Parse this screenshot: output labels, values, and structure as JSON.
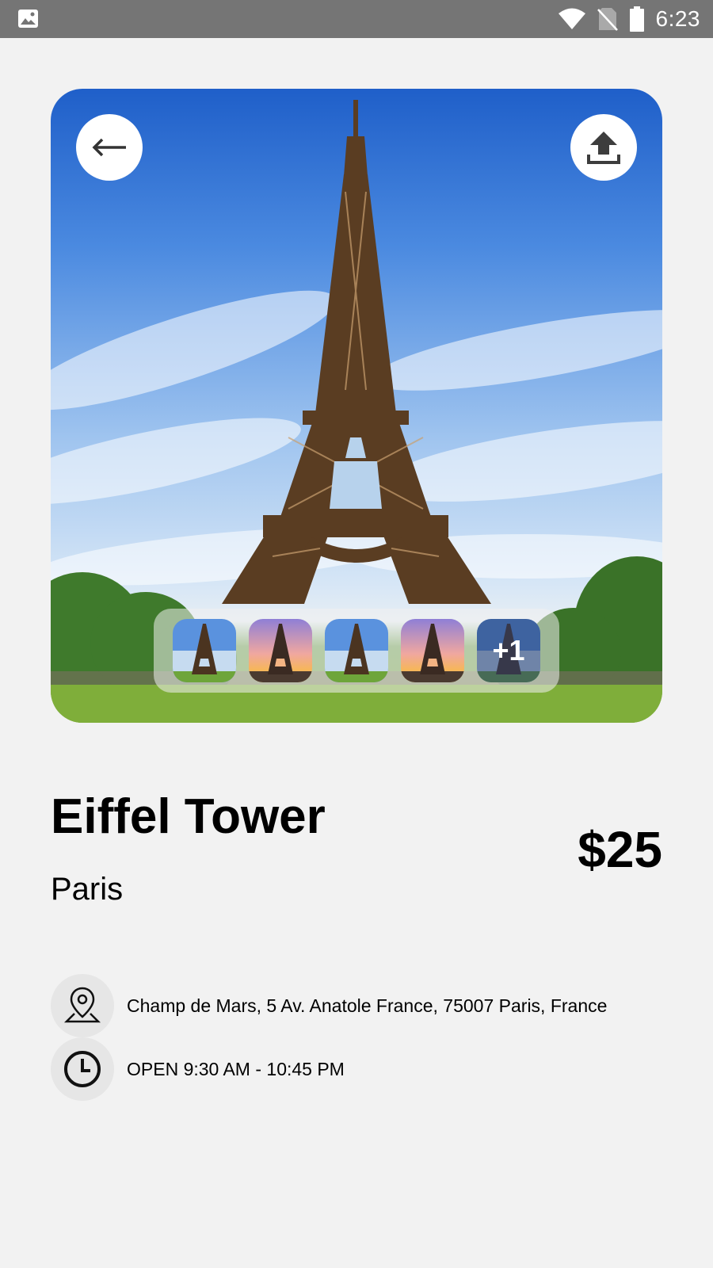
{
  "status_bar": {
    "time": "6:23",
    "icons": [
      "image-notification-icon",
      "wifi-icon",
      "no-sim-icon",
      "battery-icon"
    ]
  },
  "hero": {
    "back_icon": "arrow-left-icon",
    "share_icon": "upload-icon",
    "thumbnails": [
      {
        "variant": "day"
      },
      {
        "variant": "sunset"
      },
      {
        "variant": "day"
      },
      {
        "variant": "sunset"
      },
      {
        "variant": "more",
        "label": "+1"
      }
    ]
  },
  "place": {
    "name": "Eiffel Tower",
    "city": "Paris",
    "price": "$25"
  },
  "details": {
    "address": "Champ de Mars, 5 Av. Anatole France, 75007 Paris, France",
    "address_icon": "location-pin-icon",
    "hours": "OPEN 9:30 AM - 10:45 PM",
    "hours_icon": "clock-icon"
  },
  "colors": {
    "background": "#f2f2f2",
    "status_bar": "#757575",
    "icon_circle": "#e6e6e6",
    "text": "#000000"
  }
}
